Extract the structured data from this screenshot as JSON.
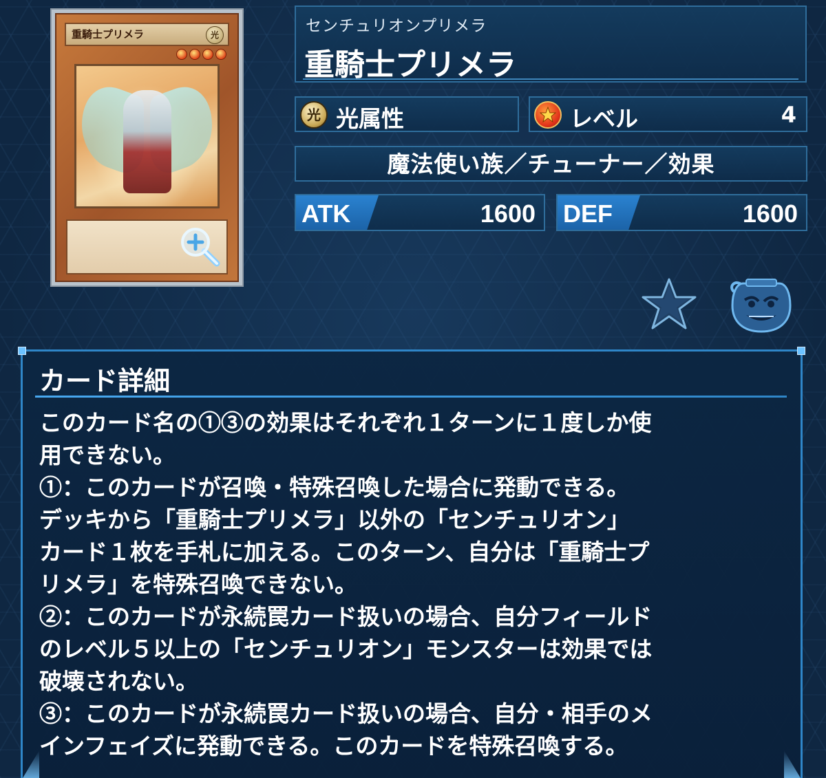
{
  "card": {
    "image_name": "重騎士プリメラ",
    "image_attribute": "光",
    "image_level_stars": 4
  },
  "header": {
    "ruby": "センチュリオンプリメラ",
    "name": "重騎士プリメラ"
  },
  "attribute": {
    "icon_char": "光",
    "label": "光属性"
  },
  "level": {
    "label": "レベル",
    "value": "4"
  },
  "type_line": "魔法使い族／チューナー／効果",
  "stats": {
    "atk_label": "ATK",
    "atk_value": "1600",
    "def_label": "DEF",
    "def_value": "1600"
  },
  "actions": {
    "favorite_icon": "star-icon",
    "jar_icon": "pot-of-greed-icon"
  },
  "detail": {
    "title": "カード詳細",
    "text": "このカード名の①③の効果はそれぞれ１ターンに１度しか使\n用できない。\n①：このカードが召喚・特殊召喚した場合に発動できる。\nデッキから「重騎士プリメラ」以外の「センチュリオン」\nカード１枚を手札に加える。このターン、自分は「重騎士プ\nリメラ」を特殊召喚できない。\n②：このカードが永続罠カード扱いの場合、自分フィールド\nのレベル５以上の「センチュリオン」モンスターは効果では\n破壊されない。\n③：このカードが永続罠カード扱いの場合、自分・相手のメ\nインフェイズに発動できる。このカードを特殊召喚する。"
  },
  "colors": {
    "background": "#0f2742",
    "panel_border": "#2f6d9b",
    "accent_blue": "#2a82d0",
    "card_frame_orange": "#c77a3c"
  }
}
